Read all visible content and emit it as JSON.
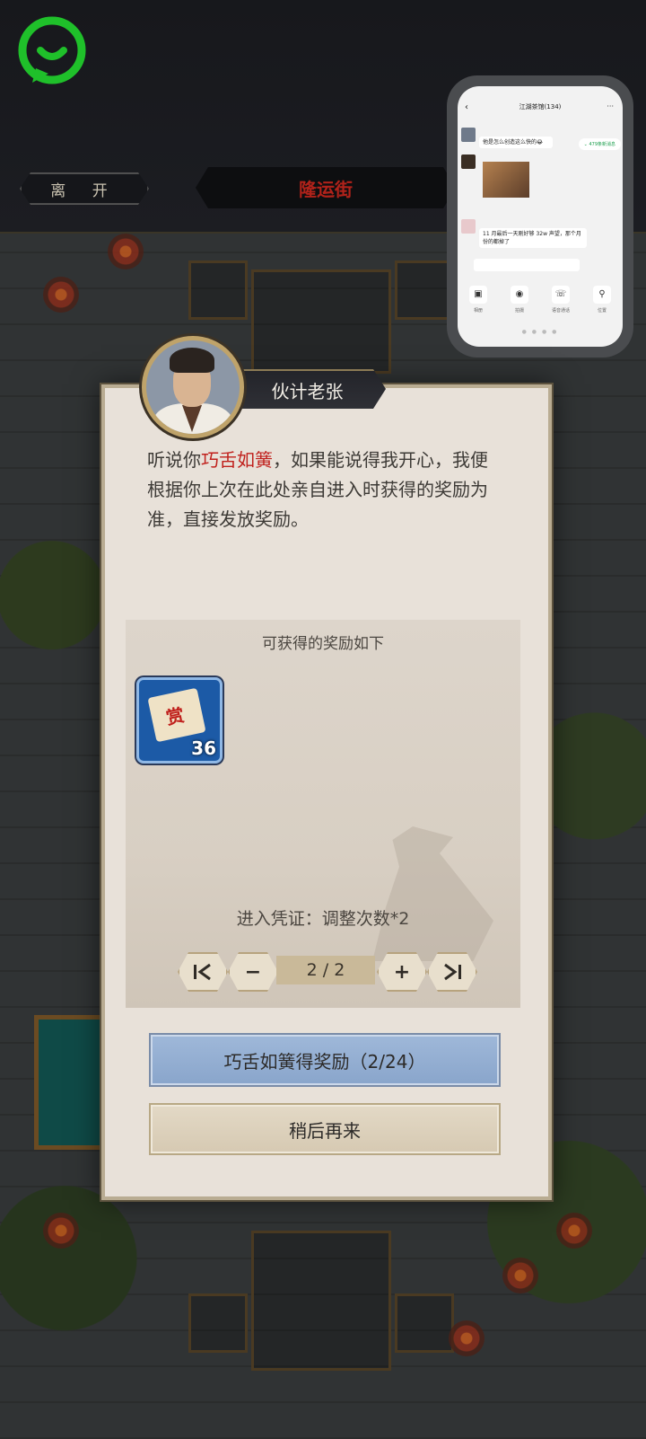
{
  "top_bar": {
    "leave_label": "离 开",
    "location_title": "隆运街"
  },
  "overlay_chat": {
    "title": "江湖茶馆(134)",
    "message_1": "他是怎么创造这么快的😂",
    "unread_notice": "⌄ 479条新消息",
    "message_2": "11 月最后一天刚好够 32w 声望，那个月份的都掉了",
    "actions": [
      "相册",
      "拍摄",
      "语音通话",
      "位置"
    ]
  },
  "dialog": {
    "npc_name": "伙计老张",
    "text_before": "听说你",
    "text_highlight": "巧舌如簧",
    "text_after": "，如果能说得我开心，我便根据你上次在此处亲自进入时获得的奖励为准，直接发放奖励。",
    "reward_title": "可获得的奖励如下",
    "reward_item_count": "36",
    "entry_requirement": "进入凭证：调整次数*2",
    "pager": {
      "first_icon": "first-page",
      "minus": "−",
      "count": "2 / 2",
      "plus": "+",
      "last_icon": "last-page"
    },
    "primary_button": "巧舌如簧得奖励（2/24）",
    "secondary_button": "稍后再来"
  },
  "colors": {
    "highlight": "#c0201c",
    "primary_button": "#9fb8d9",
    "app_logo": "#1fc02a"
  }
}
